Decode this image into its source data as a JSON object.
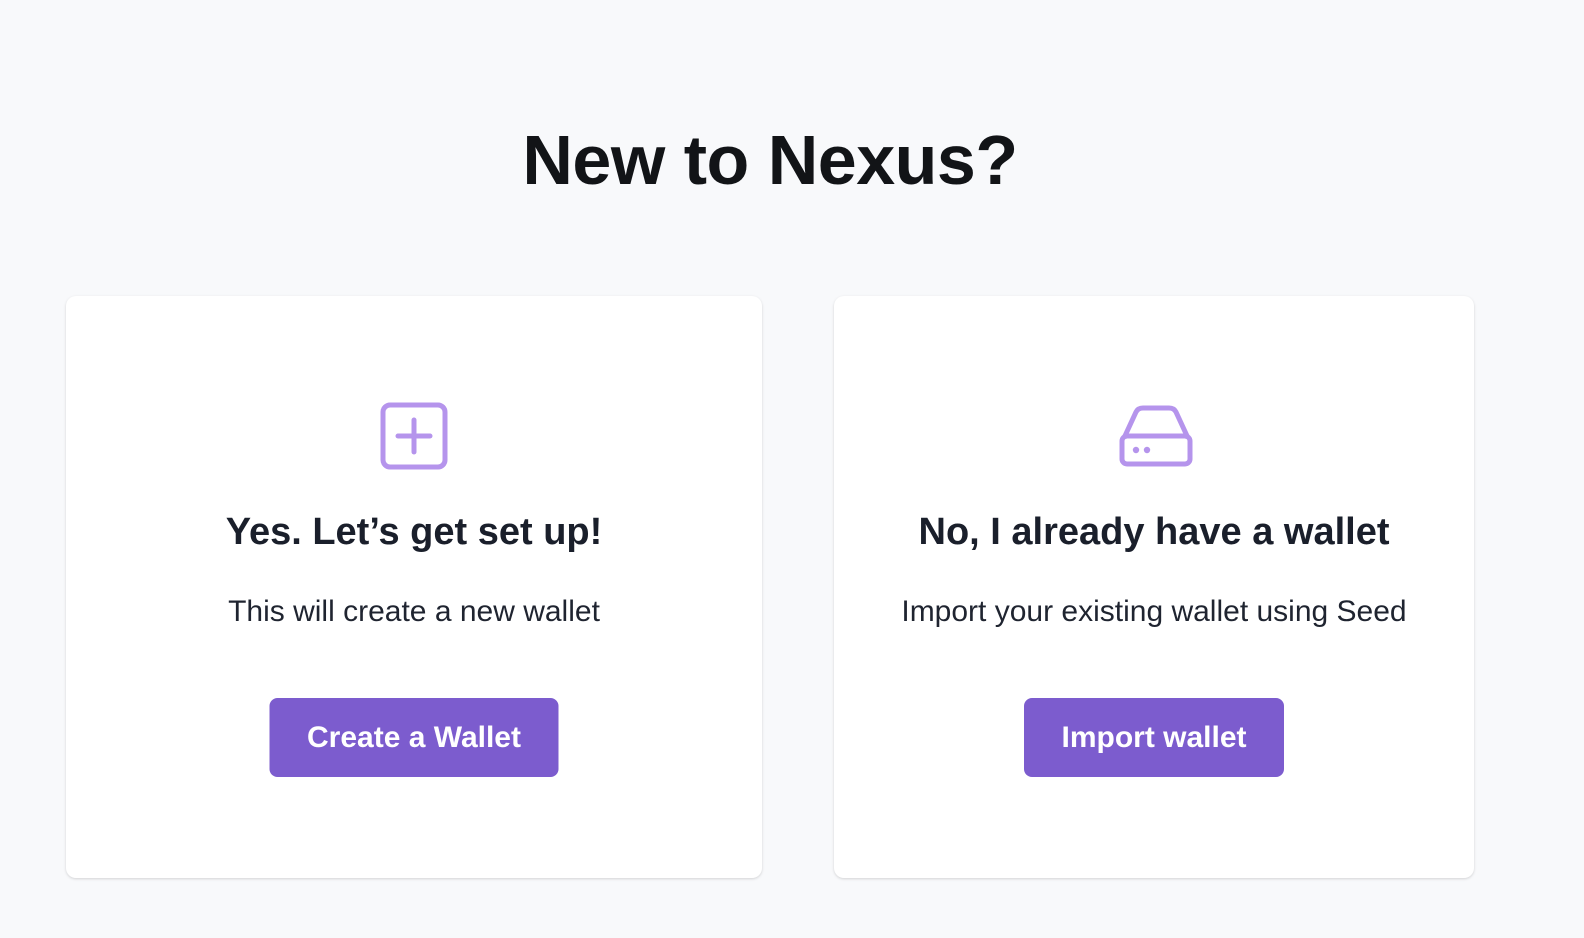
{
  "page": {
    "title": "New to Nexus?"
  },
  "create_card": {
    "icon": "plus-square-icon",
    "heading": "Yes. Let’s get set up!",
    "description": "This will create a new wallet",
    "button_label": "Create a Wallet"
  },
  "import_card": {
    "icon": "hard-drive-icon",
    "heading": "No, I already have a wallet",
    "description": "Import your existing wallet using Seed",
    "button_label": "Import wallet"
  },
  "colors": {
    "background": "#f8f9fb",
    "card": "#ffffff",
    "accent": "#7c5cce",
    "icon": "#b594ec",
    "text": "#151a24"
  }
}
